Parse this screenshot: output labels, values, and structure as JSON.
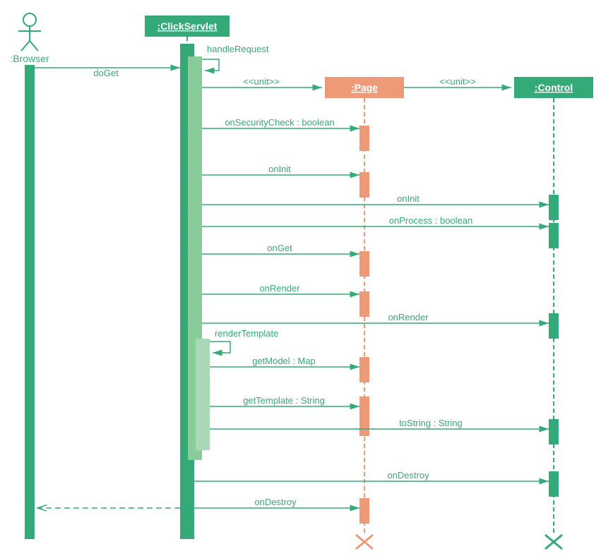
{
  "actors": {
    "browser": ":Browser",
    "clickServlet": ":ClickServlet",
    "page": ":Page",
    "control": ":Control"
  },
  "messages": {
    "doGet": "doGet",
    "handleRequest": "handleRequest",
    "unit1": "<<unit>>",
    "unit2": "<<unit>>",
    "onSecurityCheck": "onSecurityCheck : boolean",
    "onInit": "onInit",
    "onInitControl": "onInit",
    "onProcess": "onProcess : boolean",
    "onGet": "onGet",
    "onRender": "onRender",
    "onRenderControl": "onRender",
    "renderTemplate": "renderTemplate",
    "getModel": "getModel : Map",
    "getTemplate": "getTemplate : String",
    "toString": "toString : String",
    "onDestroyControl": "onDestroy",
    "onDestroy": "onDestroy"
  },
  "colors": {
    "green": "#33aa77",
    "greenDark": "#1a9966",
    "greenLight": "#88cc99",
    "greenPale": "#a8d8b8",
    "salmon": "#ee9977",
    "salmonLight": "#f5c0aa",
    "textGreen": "#33aa77"
  }
}
